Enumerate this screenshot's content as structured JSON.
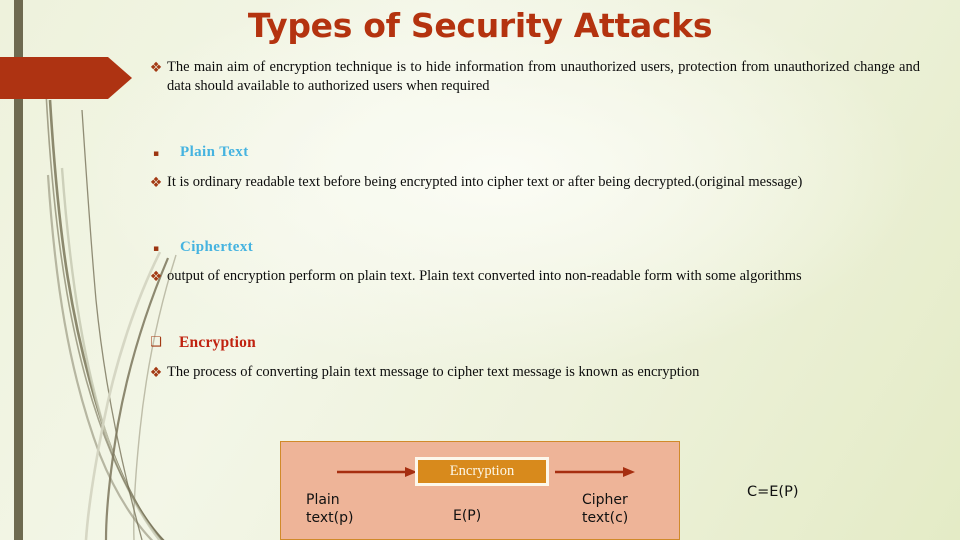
{
  "slide": {
    "title": "Types of Security Attacks",
    "colors": {
      "title": "#b4330f",
      "heading_blue": "#45b3e0",
      "heading_red": "#c0220f",
      "accent_red": "#a33a14",
      "diagram_bg": "#eeb498",
      "encryption_box": "#d88a1c",
      "left_bar": "#6e6a50",
      "background": "#eef2dc"
    }
  },
  "content": [
    {
      "id": "intro",
      "bullet": "diamond-bullet",
      "text": "The main aim of encryption technique is to hide information from unauthorized users, protection from unauthorized change and data should available to authorized users when required"
    },
    {
      "id": "plain-text-heading",
      "bullet": "square-bullet",
      "text": "Plain Text"
    },
    {
      "id": "plain-text-body",
      "bullet": "diamond-bullet",
      "text": "It is ordinary readable text before being encrypted into cipher text or after being decrypted.(original message)"
    },
    {
      "id": "ciphertext-heading",
      "bullet": "square-bullet",
      "text": "Ciphertext"
    },
    {
      "id": "ciphertext-body",
      "bullet": "diamond-bullet",
      "text": "output of encryption perform on plain text. Plain text converted into non-readable form with some algorithms"
    },
    {
      "id": "encryption-heading",
      "bullet": "hollow-square-bullet",
      "text": "Encryption"
    },
    {
      "id": "encryption-body",
      "bullet": "diamond-bullet",
      "text": "The process of converting plain text message to cipher text message is known as encryption"
    }
  ],
  "diagram": {
    "process_label": "Encryption",
    "input_label": "Plain\ntext(p)",
    "function_label": "E(P)",
    "output_label": "Cipher\ntext(c)",
    "formula": "C=E(P)",
    "bullets": {
      "diamond": "❖",
      "square": "▪",
      "hollow_square": "❑"
    }
  }
}
